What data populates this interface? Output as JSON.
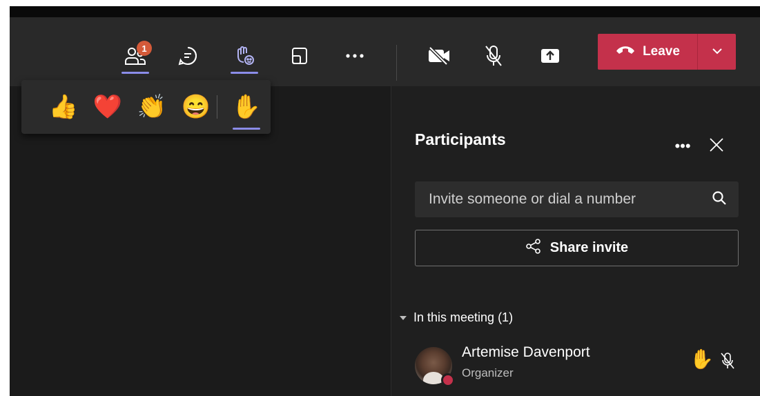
{
  "toolbar": {
    "participants_badge": "1",
    "leave_label": "Leave",
    "icons": [
      "people-icon",
      "chat-icon",
      "reactions-icon",
      "rooms-icon",
      "more-icon",
      "camera-off-icon",
      "mic-off-icon",
      "share-tray-icon",
      "phone-hangup-icon",
      "chevron-down-icon"
    ]
  },
  "reactions": {
    "items": [
      "👍",
      "❤️",
      "👏",
      "😄",
      "✋"
    ]
  },
  "participants_panel": {
    "title": "Participants",
    "more_label": "•••",
    "invite_placeholder": "Invite someone or dial a number",
    "share_invite_label": "Share invite",
    "section_label": "In this meeting (1)",
    "participant": {
      "name": "Artemise Davenport",
      "role": "Organizer",
      "hand": "✋"
    }
  },
  "colors": {
    "accent": "#8b8ce8",
    "leave_red": "#c4314b",
    "badge_orange": "#d45a39",
    "background": "#1f1f1f",
    "toolbar": "#292929"
  }
}
